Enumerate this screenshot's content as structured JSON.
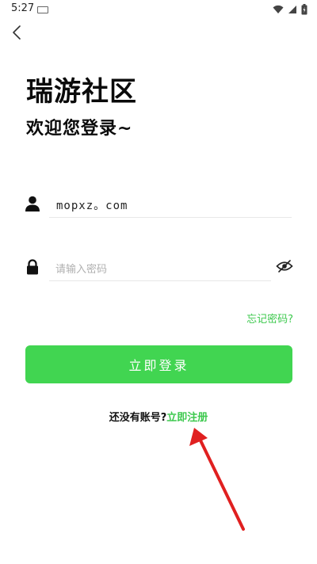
{
  "status_bar": {
    "time": "5:27"
  },
  "header": {
    "app_title": "瑞游社区",
    "welcome": "欢迎您登录~"
  },
  "form": {
    "username_value": "mopxz。com",
    "password_placeholder": "请输入密码",
    "forgot_password": "忘记密码?",
    "login_button": "立即登录"
  },
  "register": {
    "prompt": "还没有账号?",
    "link": "立即注册"
  },
  "colors": {
    "accent": "#41d551",
    "annotation": "#e02020"
  },
  "icons": [
    "back-arrow-icon",
    "user-icon",
    "lock-icon",
    "eye-hidden-icon",
    "wifi-icon",
    "signal-icon",
    "battery-icon"
  ]
}
